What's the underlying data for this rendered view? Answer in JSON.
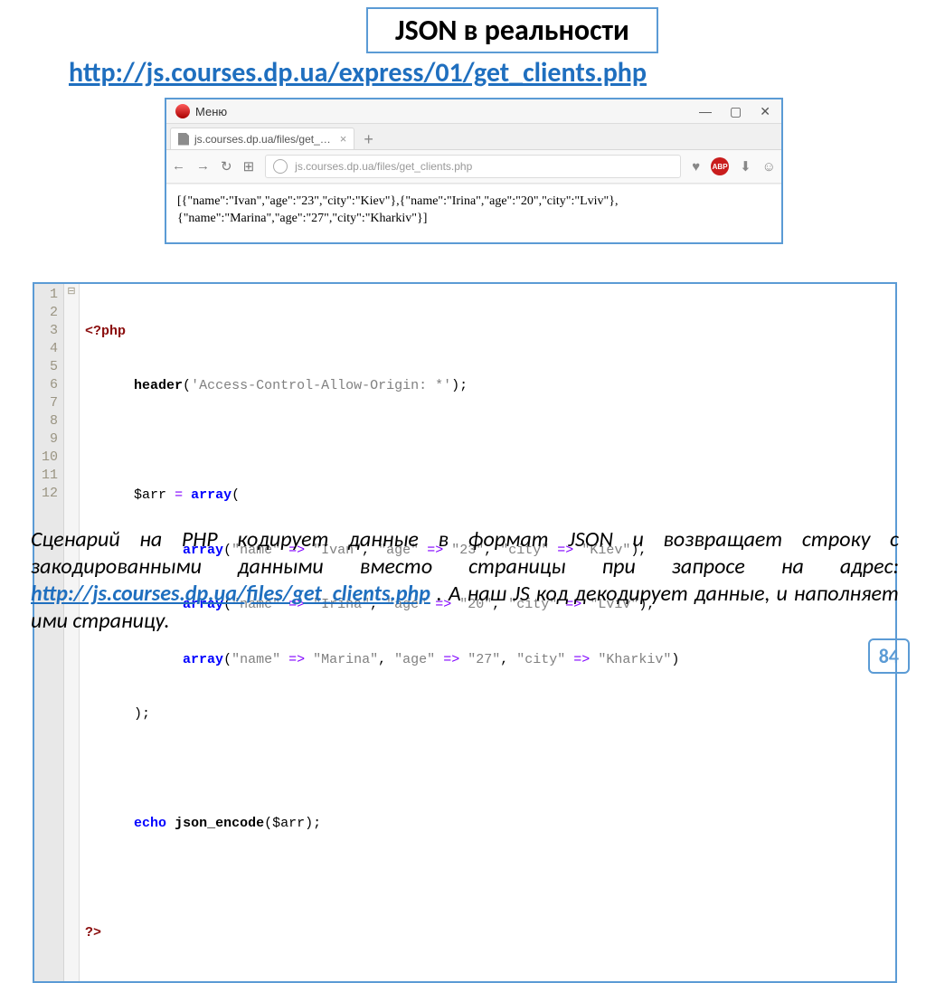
{
  "title": "JSON в реальности",
  "main_url": "http://js.courses.dp.ua/express/01/get_clients.php",
  "browser": {
    "menu_label": "Меню",
    "tab_title": "js.courses.dp.ua/files/get_…",
    "address": "js.courses.dp.ua/files/get_clients.php",
    "abp": "ABP",
    "body": "[{\"name\":\"Ivan\",\"age\":\"23\",\"city\":\"Kiev\"},{\"name\":\"Irina\",\"age\":\"20\",\"city\":\"Lviv\"},{\"name\":\"Marina\",\"age\":\"27\",\"city\":\"Kharkiv\"}]"
  },
  "code": {
    "lines": [
      "1",
      "2",
      "3",
      "4",
      "5",
      "6",
      "7",
      "8",
      "9",
      "10",
      "11",
      "12"
    ],
    "l1_open": "<?php",
    "l2_fn": "header",
    "l2_str": "'Access-Control-Allow-Origin: *'",
    "l4_var": "$arr",
    "l4_kw": "array",
    "l5_kw": "array",
    "l5_k1": "\"name\"",
    "l5_v1": "\"Ivan\"",
    "l5_k2": "\"age\"",
    "l5_v2": "\"23\"",
    "l5_k3": "\"city\"",
    "l5_v3": "\"Kiev\"",
    "l6_kw": "array",
    "l6_k1": "\"name\"",
    "l6_v1": "\"Irina\"",
    "l6_k2": "\"age\"",
    "l6_v2": "\"20\"",
    "l6_k3": "\"city\"",
    "l6_v3": "\"Lviv\"",
    "l7_kw": "array",
    "l7_k1": "\"name\"",
    "l7_v1": "\"Marina\"",
    "l7_k2": "\"age\"",
    "l7_v2": "\"27\"",
    "l7_k3": "\"city\"",
    "l7_v3": "\"Kharkiv\"",
    "l10_kw": "echo",
    "l10_fn": "json_encode",
    "l10_var": "$arr",
    "l12_close": "?>"
  },
  "desc": {
    "part1": "Сценарий на PHP кодирует данные в формат JSON и возвращает строку с закодированными данными вместо страницы при запросе на адрес: ",
    "link": "http://js.courses.dp.ua/files/get_clients.php",
    "part2": " . А наш JS код декодирует данные, и наполняет  ими страницу."
  },
  "page_number": "84"
}
